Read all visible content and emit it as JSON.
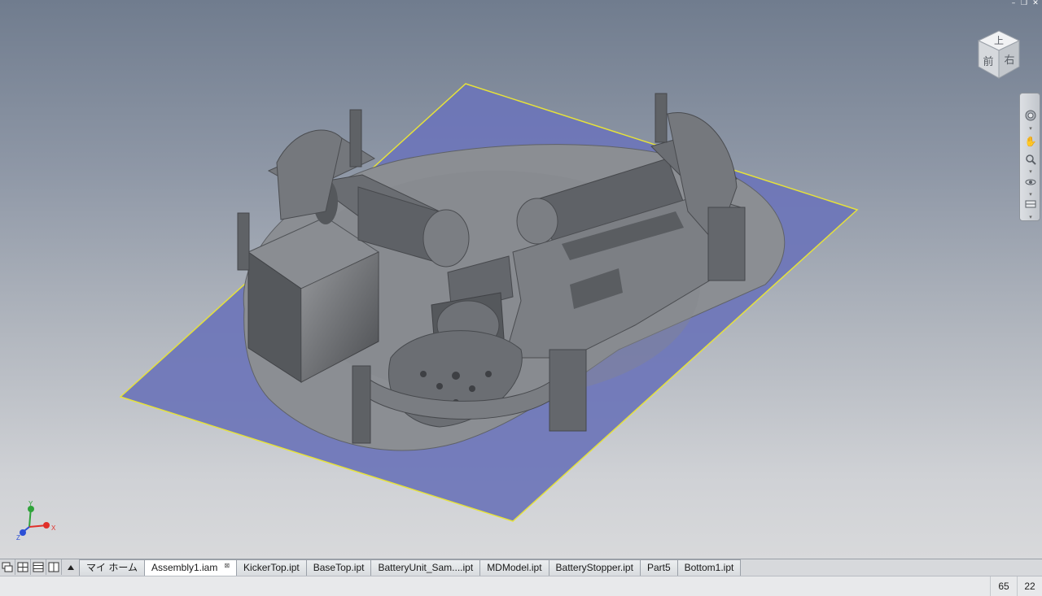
{
  "window": {
    "minimize_glyph": "–",
    "restore_glyph": "❐",
    "close_glyph": "✕"
  },
  "viewcube": {
    "top_label": "上",
    "front_label": "前",
    "right_label": "右"
  },
  "navbar": {
    "icons": [
      "steering-wheel-icon",
      "pan-icon",
      "zoom-icon",
      "orbit-icon",
      "look-at-icon"
    ]
  },
  "triad": {
    "x_label": "X",
    "y_label": "Y",
    "z_label": "Z",
    "colors": {
      "x": "#e0302a",
      "y": "#2fa33a",
      "z": "#2c4fd6"
    }
  },
  "colors": {
    "workplane_fill": "#6d75b8",
    "workplane_edge": "#e6e23a",
    "part_gray": "#6b6e73"
  },
  "tabs": [
    {
      "label": "マイ ホーム",
      "active": false,
      "closable": false
    },
    {
      "label": "Assembly1.iam",
      "active": true,
      "closable": true
    },
    {
      "label": "KickerTop.ipt",
      "active": false,
      "closable": false
    },
    {
      "label": "BaseTop.ipt",
      "active": false,
      "closable": false
    },
    {
      "label": "BatteryUnit_Sam....ipt",
      "active": false,
      "closable": false
    },
    {
      "label": "MDModel.ipt",
      "active": false,
      "closable": false
    },
    {
      "label": "BatteryStopper.ipt",
      "active": false,
      "closable": false
    },
    {
      "label": "Part5",
      "active": false,
      "closable": false
    },
    {
      "label": "Bottom1.ipt",
      "active": false,
      "closable": false
    }
  ],
  "statusbar": {
    "value1": "65",
    "value2": "22"
  }
}
